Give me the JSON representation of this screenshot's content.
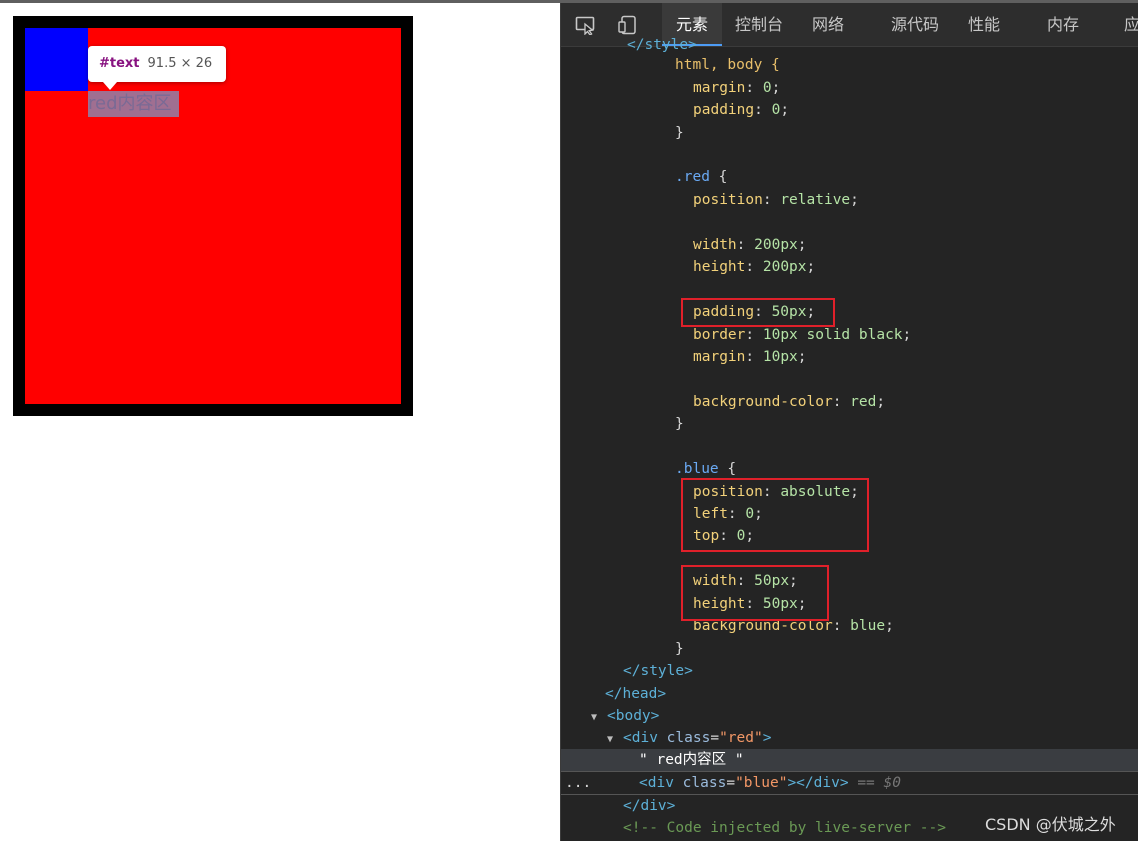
{
  "preview": {
    "text_content": "red内容区",
    "tooltip": {
      "node": "#text",
      "size": "91.5 × 26"
    }
  },
  "devtools": {
    "tabs": [
      {
        "label": "元素",
        "active": true
      },
      {
        "label": "控制台"
      },
      {
        "label": "网络"
      },
      {
        "label": "源代码"
      },
      {
        "label": "性能"
      },
      {
        "label": "内存"
      },
      {
        "label": "应"
      }
    ],
    "code": {
      "partial_top": "</style>",
      "html_body_selector": "html, body {",
      "margin": [
        "margin",
        "0"
      ],
      "padding": [
        "padding",
        "0"
      ],
      "red_selector": ".red",
      "red_props": [
        [
          "position",
          "relative"
        ],
        [
          "width",
          "200px"
        ],
        [
          "height",
          "200px"
        ],
        [
          "padding",
          "50px"
        ],
        [
          "border",
          "10px solid black"
        ],
        [
          "margin",
          "10px"
        ],
        [
          "background-color",
          "red"
        ]
      ],
      "blue_selector": ".blue",
      "blue_props": [
        [
          "position",
          "absolute"
        ],
        [
          "left",
          "0"
        ],
        [
          "top",
          "0"
        ],
        [
          "width",
          "50px"
        ],
        [
          "height",
          "50px"
        ],
        [
          "background-color",
          "blue"
        ]
      ],
      "style_close": "</style>",
      "head_close": "</head>",
      "body_open": "<body>",
      "div_red": {
        "tag": "div",
        "attr": "class",
        "value": "\"red\""
      },
      "text_node": "\" red内容区 \"",
      "div_blue": {
        "tag": "div",
        "attr": "class",
        "value": "\"blue\"",
        "suffix": "== $0"
      },
      "div_close": "</div>",
      "comment": "<!-- Code injected by live-server -->"
    },
    "accent": "#4d9cf5",
    "highlight_color": "#e0202a"
  },
  "watermark": "CSDN @伏城之外"
}
